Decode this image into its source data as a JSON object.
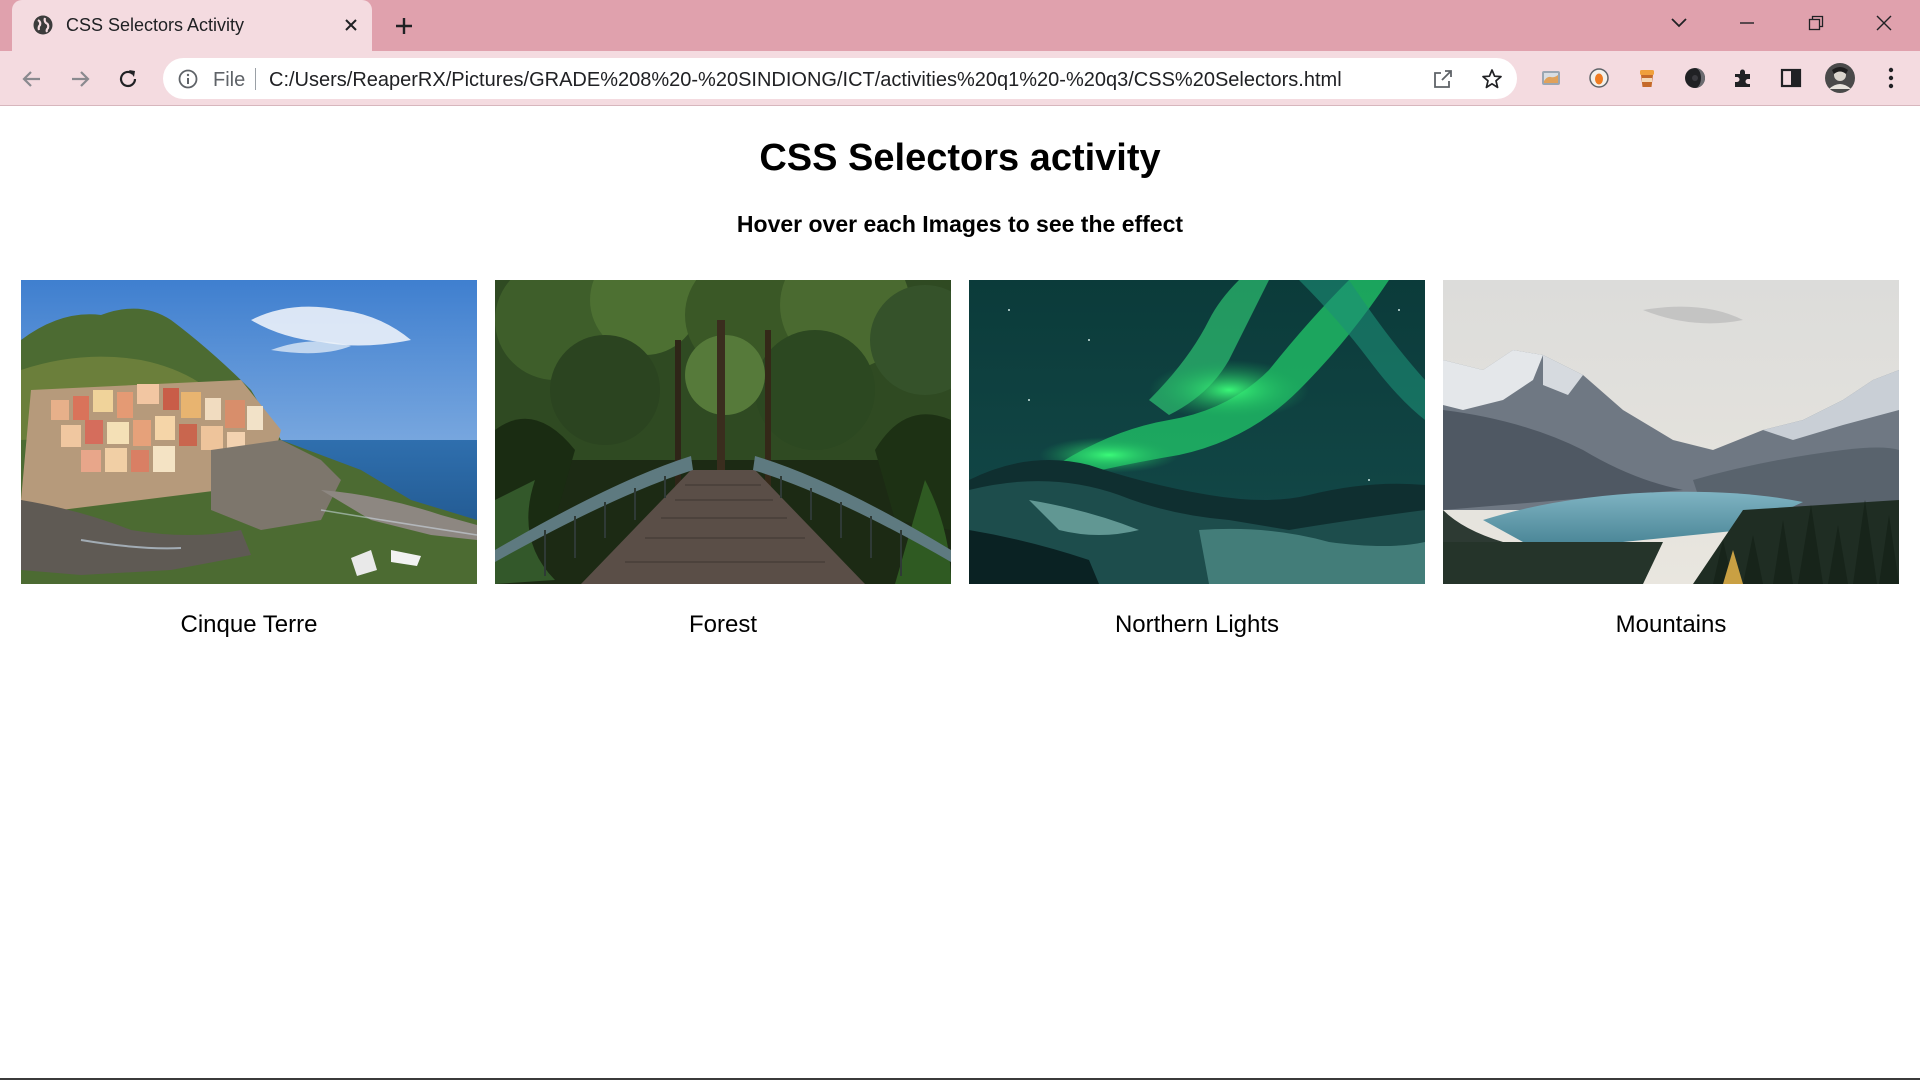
{
  "browser": {
    "tab_title": "CSS Selectors Activity",
    "scheme_label": "File",
    "url": "C:/Users/ReaperRX/Pictures/GRADE%208%20-%20SINDIONG/ICT/activities%20q1%20-%20q3/CSS%20Selectors.html",
    "theme_color": "#e0a1ad",
    "toolbar_color": "#f4dbe0"
  },
  "page": {
    "heading": "CSS Selectors activity",
    "subheading": "Hover over each Images to see the effect",
    "cards": [
      {
        "caption": "Cinque Terre",
        "image": "coastal-village-photo"
      },
      {
        "caption": "Forest",
        "image": "forest-bridge-photo"
      },
      {
        "caption": "Northern Lights",
        "image": "aurora-photo"
      },
      {
        "caption": "Mountains",
        "image": "mountain-lake-photo"
      }
    ]
  }
}
